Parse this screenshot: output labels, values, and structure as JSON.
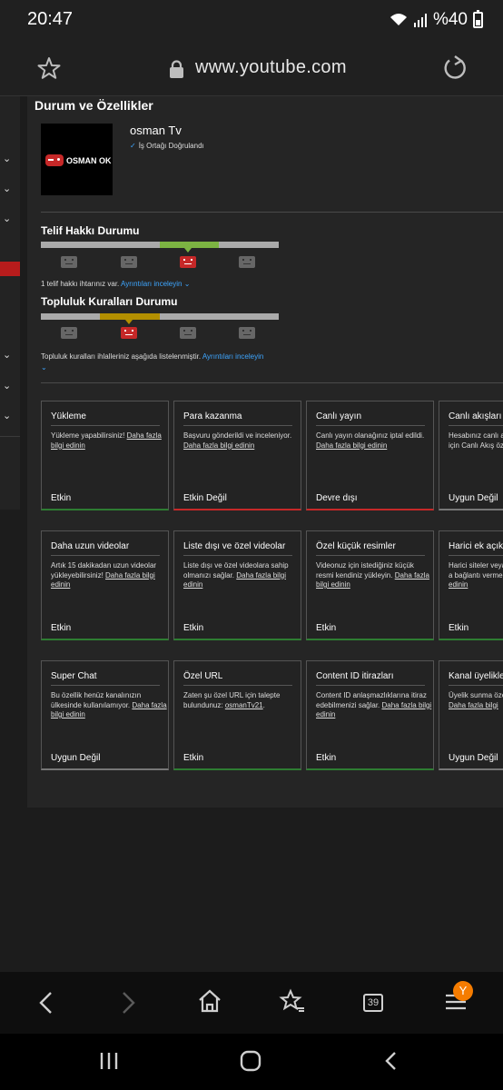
{
  "status_bar": {
    "time": "20:47",
    "battery_text": "%40"
  },
  "browser": {
    "url": "www.youtube.com",
    "tab_count": "39",
    "profile_initial": "Y"
  },
  "page": {
    "section_title": "Durum ve Özellikler",
    "channel": {
      "name": "osman Tv",
      "verified": "İş Ortağı Doğrulandı",
      "avatar_text": "OSMAN OK"
    },
    "copyright": {
      "title": "Telif Hakkı Durumu",
      "level": 3,
      "note": "1 telif hakkı ihtarınız var.",
      "link": "Ayrıntıları inceleyin"
    },
    "community": {
      "title": "Topluluk Kuralları Durumu",
      "level": 2,
      "note": "Topluluk kuralları ihlalleriniz aşağıda listelenmiştir.",
      "link": "Ayrıntıları inceleyin"
    },
    "cards": [
      {
        "title": "Yükleme",
        "desc": "Yükleme yapabilirsiniz!",
        "link": "Daha fazla bilgi edinin",
        "status": "Etkin"
      },
      {
        "title": "Para kazanma",
        "desc": "Başvuru gönderildi ve inceleniyor.",
        "link": "Daha fazla bilgi edinin",
        "status": "Etkin Değil"
      },
      {
        "title": "Canlı yayın",
        "desc": "Canlı yayın olanağınız iptal edildi.",
        "link": "Daha fazla bilgi edinin",
        "status": "Devre dışı"
      },
      {
        "title": "Canlı akışları ya",
        "desc": "Hesabınız canlı a etkinleştirilmedi. için Canlı Akış öz bakın.",
        "link": "",
        "status": "Uygun Değil"
      },
      {
        "title": "Daha uzun videolar",
        "desc": "Artık 15 dakikadan uzun videolar yükleyebilirsiniz!",
        "link": "Daha fazla bilgi edinin",
        "status": "Etkin"
      },
      {
        "title": "Liste dışı ve özel videolar",
        "desc": "Liste dışı ve özel videolara sahip olmanızı sağlar.",
        "link": "Daha fazla bilgi edinin",
        "status": "Etkin"
      },
      {
        "title": "Özel küçük resimler",
        "desc": "Videonuz için istediğiniz küçük resmi kendiniz yükleyin.",
        "link": "Daha fazla bilgi edinin",
        "status": "Etkin"
      },
      {
        "title": "Harici ek açıkla",
        "desc": "Harici siteler veya ortaklarını için ek a bağlantı vermeni",
        "link": "Daha fazla bilgi edinin",
        "status": "Etkin"
      },
      {
        "title": "Super Chat",
        "desc": "Bu özellik henüz kanalınızın ülkesinde kullanılamıyor.",
        "link": "Daha fazla bilgi edinin",
        "status": "Uygun Değil"
      },
      {
        "title": "Özel URL",
        "desc": "Zaten şu özel URL için talepte bulundunuz:",
        "link": "osmanTv21",
        "suffix": ".",
        "status": "Etkin"
      },
      {
        "title": "Content ID itirazları",
        "desc": "Content ID anlaşmazlıklarına itiraz edebilmenizi sağlar.",
        "link": "Daha fazla bilgi edinin",
        "status": "Etkin"
      },
      {
        "title": "Kanal üyelikler",
        "desc": "Üyelik sunma özel kanalınızda kulla",
        "link": "Daha fazla bilgi",
        "status": "Uygun Değil"
      }
    ]
  },
  "colors": {
    "active": "#2e7d32",
    "inactive": "#c62828",
    "ineligible": "#777777",
    "link": "#3ea6ff"
  }
}
